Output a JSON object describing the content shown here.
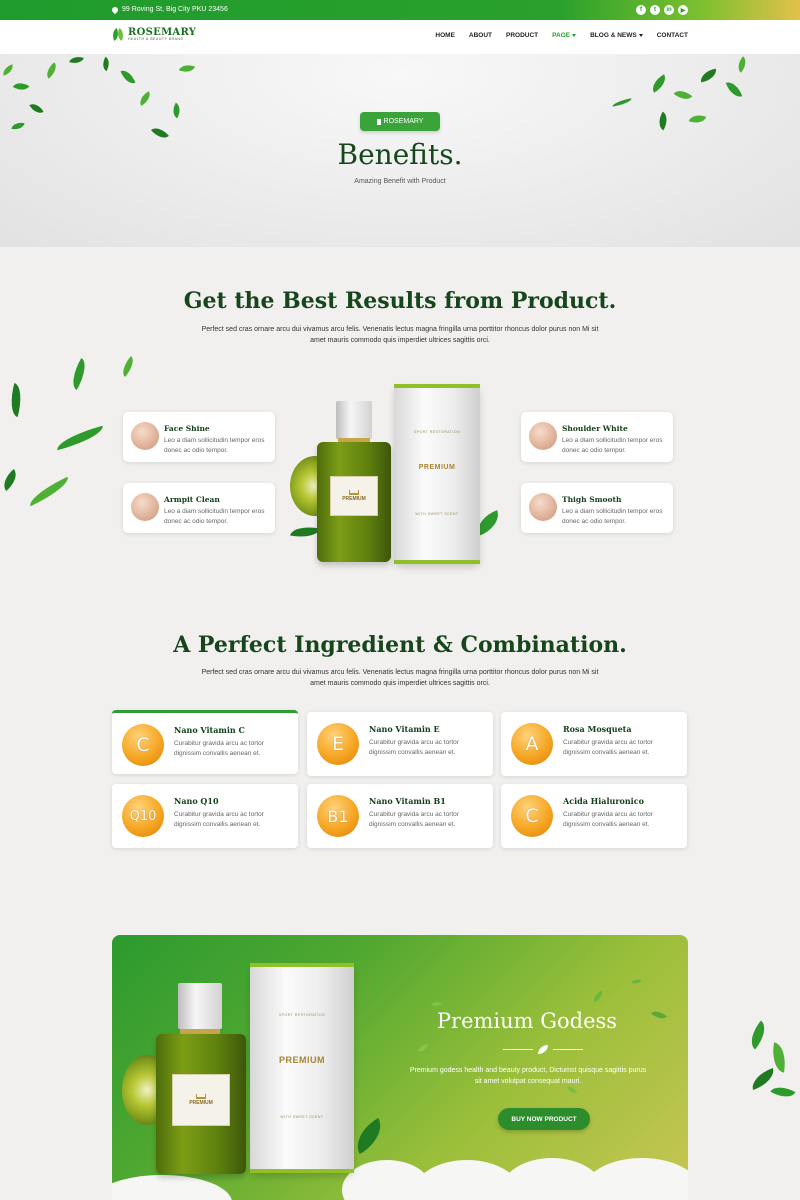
{
  "topbar": {
    "address": "99 Roving St, Big City PKU 23456",
    "socials": [
      "f",
      "t",
      "in",
      "▶"
    ]
  },
  "brand": {
    "name": "ROSEMARY",
    "tagline": "HEALTH & BEAUTY BRAND"
  },
  "nav": {
    "items": [
      {
        "label": "HOME"
      },
      {
        "label": "ABOUT"
      },
      {
        "label": "PRODUCT"
      },
      {
        "label": "PAGE"
      },
      {
        "label": "BLOG & NEWS"
      },
      {
        "label": "CONTACT"
      }
    ]
  },
  "hero": {
    "badge": "ROSEMARY",
    "title": "Benefits.",
    "subtitle": "Amazing Benefit with Product"
  },
  "results": {
    "title": "Get the Best Results from Product.",
    "text": "Perfect sed cras ornare arcu dui vivamus arcu felis. Venenatis lectus magna fringilla urna porttitor rhoncus dolor purus non Mi sit amet mauris commodo quis imperdiet ultrices sagittis orci.",
    "benefits": [
      {
        "title": "Face Shine",
        "desc": "Leo a diam sollicitudin tempor eros donec ac odio tempor."
      },
      {
        "title": "Armpit Clean",
        "desc": "Leo a diam sollicitudin tempor eros donec ac odio tempor."
      },
      {
        "title": "Shoulder White",
        "desc": "Leo a diam sollicitudin tempor eros donec ac odio tempor."
      },
      {
        "title": "Thigh Smooth",
        "desc": "Leo a diam sollicitudin tempor eros donec ac odio tempor."
      }
    ]
  },
  "product_render": {
    "bottle_label": "PREMIUM",
    "tube_top": "SPORT RESTORATION",
    "tube_main": "PREMIUM",
    "tube_sub": "WITH SWEET SCENT"
  },
  "ingredients": {
    "title": "A Perfect Ingredient & Combination.",
    "text": "Perfect sed cras ornare arcu dui vivamus arcu felis. Venenatis lectus magna fringilla urna porttitor rhoncus dolor purus non Mi sit amet mauris commodo quis imperdiet ultrices sagittis orci.",
    "items": [
      {
        "symbol": "C",
        "title": "Nano Vitamin C",
        "desc": "Curabitur gravida arcu ac tortor dignissim convallis aenean et."
      },
      {
        "symbol": "E",
        "title": "Nano Vitamin E",
        "desc": "Curabitur gravida arcu ac tortor dignissim convallis aenean et."
      },
      {
        "symbol": "A",
        "title": "Rosa Mosqueta",
        "desc": "Curabitur gravida arcu ac tortor dignissim convallis aenean et."
      },
      {
        "symbol": "Q10",
        "title": "Nano Q10",
        "desc": "Curabitur gravida arcu ac tortor dignissim convallis aenean et."
      },
      {
        "symbol": "B1",
        "title": "Nano Vitamin B1",
        "desc": "Curabitur gravida arcu ac tortor dignissim convallis aenean et."
      },
      {
        "symbol": "C",
        "title": "Acida Hialuronico",
        "desc": "Curabitur gravida arcu ac tortor dignissim convallis aenean et."
      }
    ]
  },
  "promo": {
    "title": "Premium Godess",
    "text": "Premium godess health and beauty product, Dictumst quisque sagittis purus sit amet volutpat consequat mauri.",
    "button": "BUY NOW PRODUCT"
  },
  "colors": {
    "primary_green": "#2aa12c",
    "heading_green": "#17461c",
    "accent_orange": "#f5a623"
  }
}
